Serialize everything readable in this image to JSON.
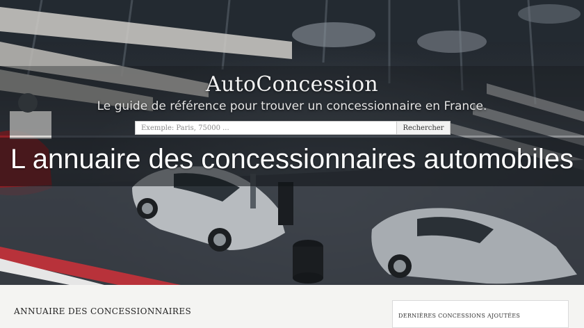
{
  "header": {
    "site_title": "AutoConcession",
    "tagline": "Le guide de référence pour trouver un concessionnaire en France.",
    "hero_heading": "L annuaire des concessionnaires automobiles"
  },
  "search": {
    "placeholder": "Exemple: Paris, 75000 ...",
    "button_label": "Rechercher"
  },
  "main": {
    "section_heading": "ANNUAIRE DES CONCESSIONNAIRES"
  },
  "sidebar": {
    "heading": "DERNIÈRES CONCESSIONS AJOUTÉES"
  }
}
